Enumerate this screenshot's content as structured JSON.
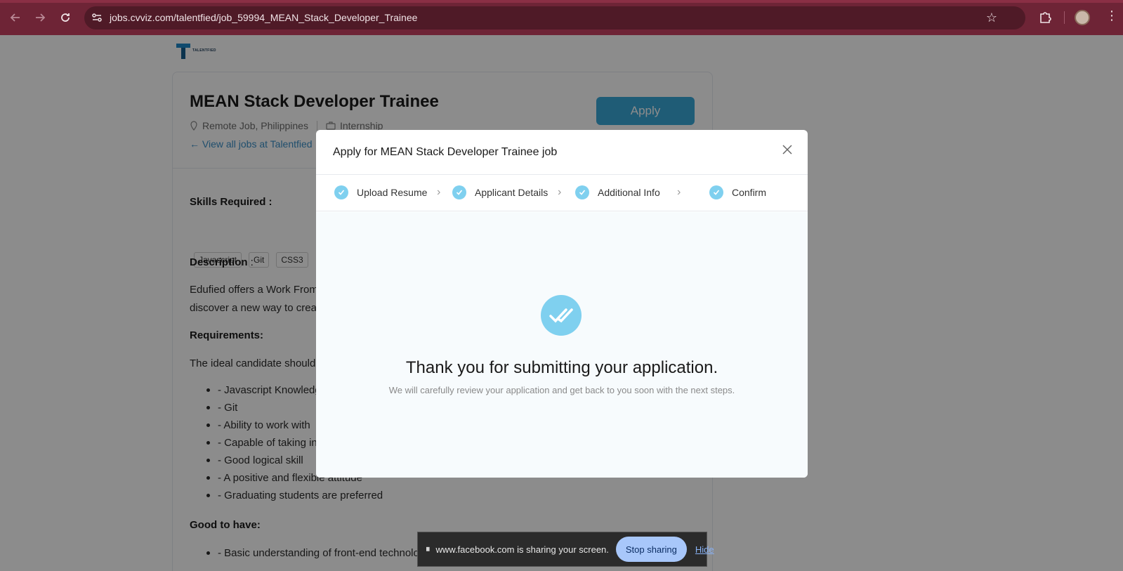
{
  "browser": {
    "url": "jobs.cvviz.com/talentfied/job_59994_MEAN_Stack_Developer_Trainee",
    "icons": [
      "back-arrow-icon",
      "forward-arrow-icon",
      "reload-icon",
      "site-settings-icon",
      "bookmark-star-icon",
      "extensions-icon",
      "profile-avatar",
      "kebab-menu-icon"
    ]
  },
  "company": {
    "logo_text": "TALENTFIED"
  },
  "job": {
    "title": "MEAN Stack Developer Trainee",
    "apply_label": "Apply",
    "location": "Remote Job, Philippines",
    "type": "Internship",
    "view_all_label": "View all jobs at Talentfied",
    "skills_heading": "Skills Required :",
    "skills": [
      "Javascript",
      "Git",
      "CSS3"
    ],
    "description_heading": "Description",
    "description_suffix": " :",
    "description_line1": "Edufied offers a Work From",
    "description_line2": "discover a new way to creat",
    "requirements_heading": "Requirements:",
    "requirements_intro": "The ideal candidate should",
    "requirements": [
      "- Javascript Knowledg",
      "- Git",
      "- Ability to work with",
      "- Capable of taking in",
      "- Good logical skill",
      "- A positive and flexible attitude",
      "- Graduating students are preferred"
    ],
    "good_to_have_heading": "Good to have:",
    "good_to_have": [
      "- Basic understanding of front-end technolog"
    ]
  },
  "modal": {
    "title": "Apply for MEAN Stack Developer Trainee job",
    "steps": [
      {
        "label": "Upload Resume",
        "done": true
      },
      {
        "label": "Applicant Details",
        "done": true
      },
      {
        "label": "Additional Info",
        "done": true
      },
      {
        "label": "Confirm",
        "done": true
      }
    ],
    "thank_you": "Thank you for submitting your application.",
    "sub_text": "We will carefully review your application and get back to you soon with the next steps."
  },
  "screen_share": {
    "pause_glyph": "⏸",
    "message": "www.facebook.com is sharing your screen.",
    "stop_label": "Stop sharing",
    "hide_label": "Hide"
  },
  "colors": {
    "chrome": "#6e2436",
    "accent": "#3aa8d8",
    "step_check": "#7fd0ef",
    "link": "#3a8fc7"
  }
}
